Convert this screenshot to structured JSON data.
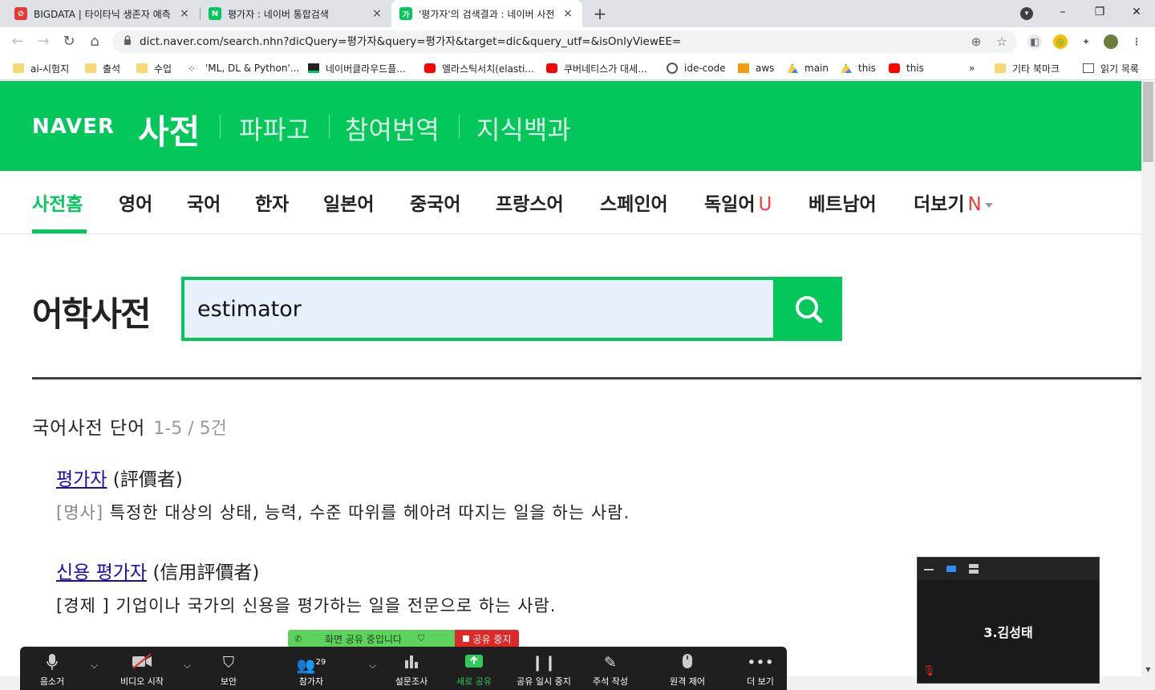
{
  "browser": {
    "tabs": [
      {
        "title": "BIGDATA | 타이타닉 생존자 예측",
        "close": "×"
      },
      {
        "title": "평가자 : 네이버 통합검색",
        "close": "×"
      },
      {
        "title": "'평가자'의 검색결과 : 네이버 사전",
        "close": "×"
      }
    ],
    "new_tab": "+",
    "window_controls": {
      "minimize": "–",
      "restore": "❐",
      "close": "✕"
    },
    "url": "dict.naver.com/search.nhn?dicQuery=평가자&query=평가자&target=dic&query_utf=&isOnlyViewEE=",
    "nav": {
      "back": "←",
      "forward": "→",
      "reload": "↻",
      "home": "⌂"
    },
    "bookmarks": [
      {
        "label": "ai-시험지",
        "icon": "folder-icon"
      },
      {
        "label": "출석",
        "icon": "folder-icon"
      },
      {
        "label": "수업",
        "icon": "folder-icon"
      },
      {
        "label": "'ML, DL & Python'...",
        "icon": "dots-icon"
      },
      {
        "label": "네이버클라우드플...",
        "icon": "dark-square-icon"
      },
      {
        "label": "엘라스틱서치(elasti...",
        "icon": "youtube-icon"
      },
      {
        "label": "쿠버네티스가 대세...",
        "icon": "youtube-icon"
      },
      {
        "label": "ide-code",
        "icon": "circle-icon"
      },
      {
        "label": "aws",
        "icon": "box-icon"
      },
      {
        "label": "main",
        "icon": "drive-icon"
      },
      {
        "label": "this",
        "icon": "drive-icon"
      },
      {
        "label": "this",
        "icon": "youtube-icon"
      }
    ],
    "bookmarks_overflow": "»",
    "other_bookmarks": "기타 북마크",
    "reading_list": "읽기 목록"
  },
  "naver": {
    "logo": "NAVER",
    "dict_title": "사전",
    "header_links": [
      "파파고",
      "참여번역",
      "지식백과"
    ],
    "lang_tabs": [
      "사전홈",
      "영어",
      "국어",
      "한자",
      "일본어",
      "중국어",
      "프랑스어",
      "스페인어",
      "독일어",
      "베트남어",
      "더보기"
    ],
    "badge_u": "U",
    "badge_n": "N",
    "search_heading": "어학사전",
    "search_value": "estimator",
    "section_title": "국어사전 단어",
    "section_count": "1-5 / 5건",
    "entries": [
      {
        "word": "평가자",
        "hanja": "(評價者)",
        "pos": "[명사]",
        "definition": "특정한 대상의 상태, 능력, 수준 따위를 헤아려 따지는 일을 하는 사람."
      },
      {
        "word": "신용 평가자",
        "hanja": "(信用評價者)",
        "pos": "[경제 ]",
        "definition": "기업이나 국가의 신용을 평가하는 일을 전문으로 하는 사람."
      }
    ]
  },
  "zoom": {
    "sharing_status": "화면 공유 중입니다",
    "stop_share": "공유 중지",
    "participant_count": "29",
    "toolbar": [
      {
        "label": "음소거",
        "icon": "microphone-icon"
      },
      {
        "label": "비디오 시작",
        "icon": "video-off-icon"
      },
      {
        "label": "보안",
        "icon": "shield-icon"
      },
      {
        "label": "참가자",
        "icon": "participants-icon"
      },
      {
        "label": "설문조사",
        "icon": "poll-icon"
      },
      {
        "label": "새로 공유",
        "icon": "share-screen-icon"
      },
      {
        "label": "공유 일시 중지",
        "icon": "pause-icon"
      },
      {
        "label": "주석 작성",
        "icon": "pencil-icon"
      },
      {
        "label": "원격 제어",
        "icon": "mouse-icon"
      },
      {
        "label": "더 보기",
        "icon": "more-icon"
      }
    ],
    "video_name": "3.김성태"
  },
  "colors": {
    "naver_green": "#03c75a",
    "link": "#1a0dab",
    "zoom_bar": "#1f1f1f",
    "stop_red": "#e02828"
  }
}
